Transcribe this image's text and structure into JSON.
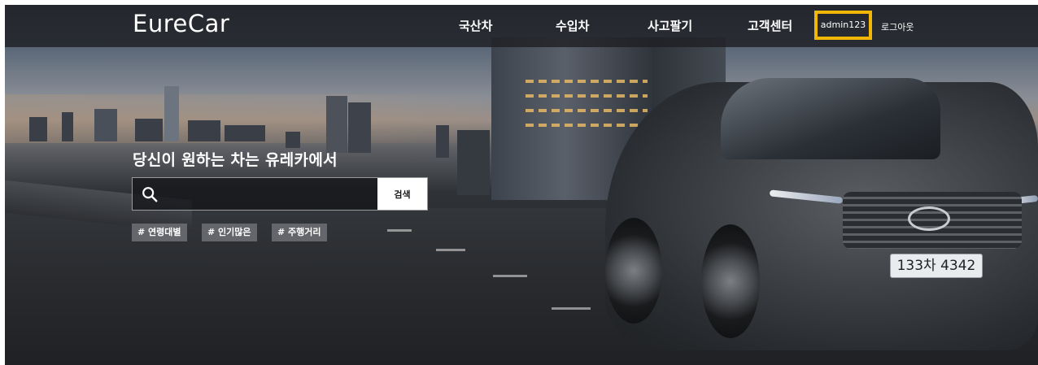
{
  "brand": {
    "name": "EureCar"
  },
  "nav": {
    "items": [
      {
        "label": "국산차"
      },
      {
        "label": "수입차"
      },
      {
        "label": "사고팔기"
      },
      {
        "label": "고객센터"
      }
    ],
    "user": "admin123",
    "logout": "로그아웃"
  },
  "hero": {
    "headline": "당신이 원하는 차는 유레카에서",
    "search": {
      "placeholder": "",
      "value": "",
      "button_label": "검색",
      "icon": "search-icon"
    },
    "tags": [
      {
        "label": "# 연령대별"
      },
      {
        "label": "# 인기많은"
      },
      {
        "label": "# 주행거리"
      }
    ],
    "car_plate": "133차 4342"
  },
  "colors": {
    "highlight": "#f2b705",
    "nav_bg": "#1e2024",
    "tag_bg": "#6e7074",
    "button_bg": "#ffffff"
  }
}
